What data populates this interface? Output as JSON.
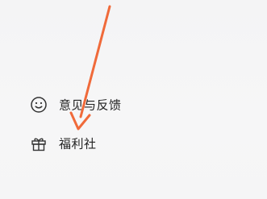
{
  "menu": {
    "items": [
      {
        "label": "意见与反馈",
        "icon": "smile-face-icon"
      },
      {
        "label": "福利社",
        "icon": "gift-icon"
      }
    ]
  },
  "annotation": {
    "arrow_color": "#f06a3a",
    "icon": "arrow-annotation"
  }
}
